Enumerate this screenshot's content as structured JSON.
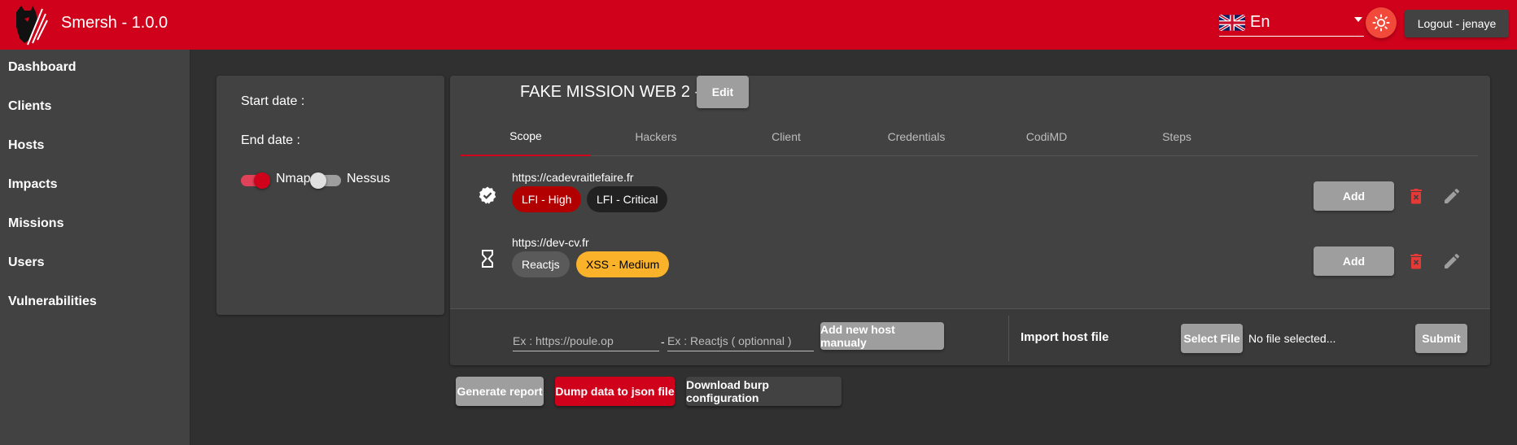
{
  "app": {
    "title": "Smersh - 1.0.0"
  },
  "header": {
    "language": "En",
    "logout_label": "Logout - jenaye"
  },
  "sidebar": {
    "items": [
      {
        "label": "Dashboard"
      },
      {
        "label": "Clients"
      },
      {
        "label": "Hosts"
      },
      {
        "label": "Impacts"
      },
      {
        "label": "Missions"
      },
      {
        "label": "Users"
      },
      {
        "label": "Vulnerabilities"
      }
    ]
  },
  "info_card": {
    "start_date_label": "Start date :",
    "end_date_label": "End date :",
    "nmap_label": "Nmap",
    "nmap_enabled": true,
    "nessus_label": "Nessus",
    "nessus_enabled": false
  },
  "mission": {
    "title": "FAKE MISSION WEB 2 -",
    "edit_label": "Edit",
    "tabs": [
      {
        "label": "Scope",
        "active": true
      },
      {
        "label": "Hackers",
        "active": false
      },
      {
        "label": "Client",
        "active": false
      },
      {
        "label": "Credentials",
        "active": false
      },
      {
        "label": "CodiMD",
        "active": false
      },
      {
        "label": "Steps",
        "active": false
      }
    ],
    "hosts": [
      {
        "url": "https://cadevraitlefaire.fr",
        "status_icon": "check-badge-icon",
        "chips": [
          {
            "label": "LFI - High",
            "bg": "#b20000",
            "fg": "#ffffff"
          },
          {
            "label": "LFI - Critical",
            "bg": "#212121",
            "fg": "#ffffff"
          }
        ],
        "add_label": "Add"
      },
      {
        "url": "https://dev-cv.fr",
        "status_icon": "hourglass-icon",
        "chips": [
          {
            "label": "Reactjs",
            "bg": "#5a5a5a",
            "fg": "#ffffff"
          },
          {
            "label": "XSS - Medium",
            "bg": "#f9b22a",
            "fg": "#000000"
          }
        ],
        "add_label": "Add"
      }
    ],
    "new_host": {
      "url_placeholder": "Ex : https://poule.op",
      "separator": "-",
      "tech_placeholder": "Ex : Reactjs ( optionnal )",
      "add_label": "Add new host manualy"
    },
    "import": {
      "label": "Import host file",
      "select_label": "Select File",
      "file_status": "No file selected...",
      "submit_label": "Submit"
    }
  },
  "actions": {
    "generate_report": "Generate report",
    "dump_json": "Dump data to json file",
    "download_burp": "Download burp configuration"
  },
  "colors": {
    "accent": "#d0021b",
    "background": "#303030",
    "panel": "#424242"
  }
}
